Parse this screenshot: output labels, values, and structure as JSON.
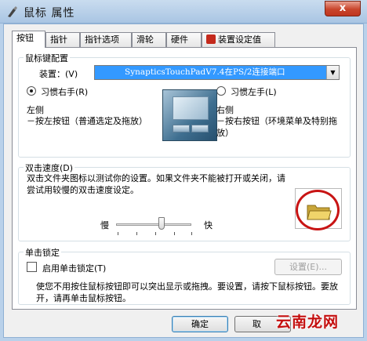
{
  "window": {
    "title": "鼠标 属性",
    "close_glyph": "x"
  },
  "tabs": [
    {
      "label": "按钮"
    },
    {
      "label": "指针"
    },
    {
      "label": "指针选项"
    },
    {
      "label": "滑轮"
    },
    {
      "label": "硬件"
    },
    {
      "label": "装置设定值"
    }
  ],
  "button_config": {
    "legend": "鼠标键配置",
    "device_label": "装置：(V)",
    "device_value": "SynapticsTouchPadV7.4在PS/2连接端口",
    "right_hand": {
      "label": "习惯右手(R)",
      "selected": true
    },
    "left_hand": {
      "label": "习惯左手(L)",
      "selected": false
    },
    "left_desc_title": "左侧",
    "left_desc": "－按左按钮（普通选定及拖放）",
    "right_desc_title": "右侧",
    "right_desc": "－按右按钮（环境菜单及特别拖放）"
  },
  "double_click": {
    "legend": "双击速度(D)",
    "description": "双击文件夹图标以测试你的设置。如果文件夹不能被打开或关闭，请尝试用较慢的双击速度设定。",
    "slow_label": "慢",
    "fast_label": "快",
    "speed_fraction": 0.6
  },
  "click_lock": {
    "legend": "单击锁定",
    "checkbox_label": "启用单击锁定(T)",
    "checked": false,
    "settings_button": "设置(E)...",
    "description": "使您不用按住鼠标按钮即可以突出显示或拖拽。要设置，请按下鼠标按钮。要放开，请再单击鼠标按钮。"
  },
  "footer": {
    "ok_label": "确定",
    "cancel_partial": "取"
  },
  "watermark": "云南龙网",
  "colors": {
    "selection": "#3399ff",
    "circle": "#c81414",
    "watermark": "#c40f0f"
  }
}
